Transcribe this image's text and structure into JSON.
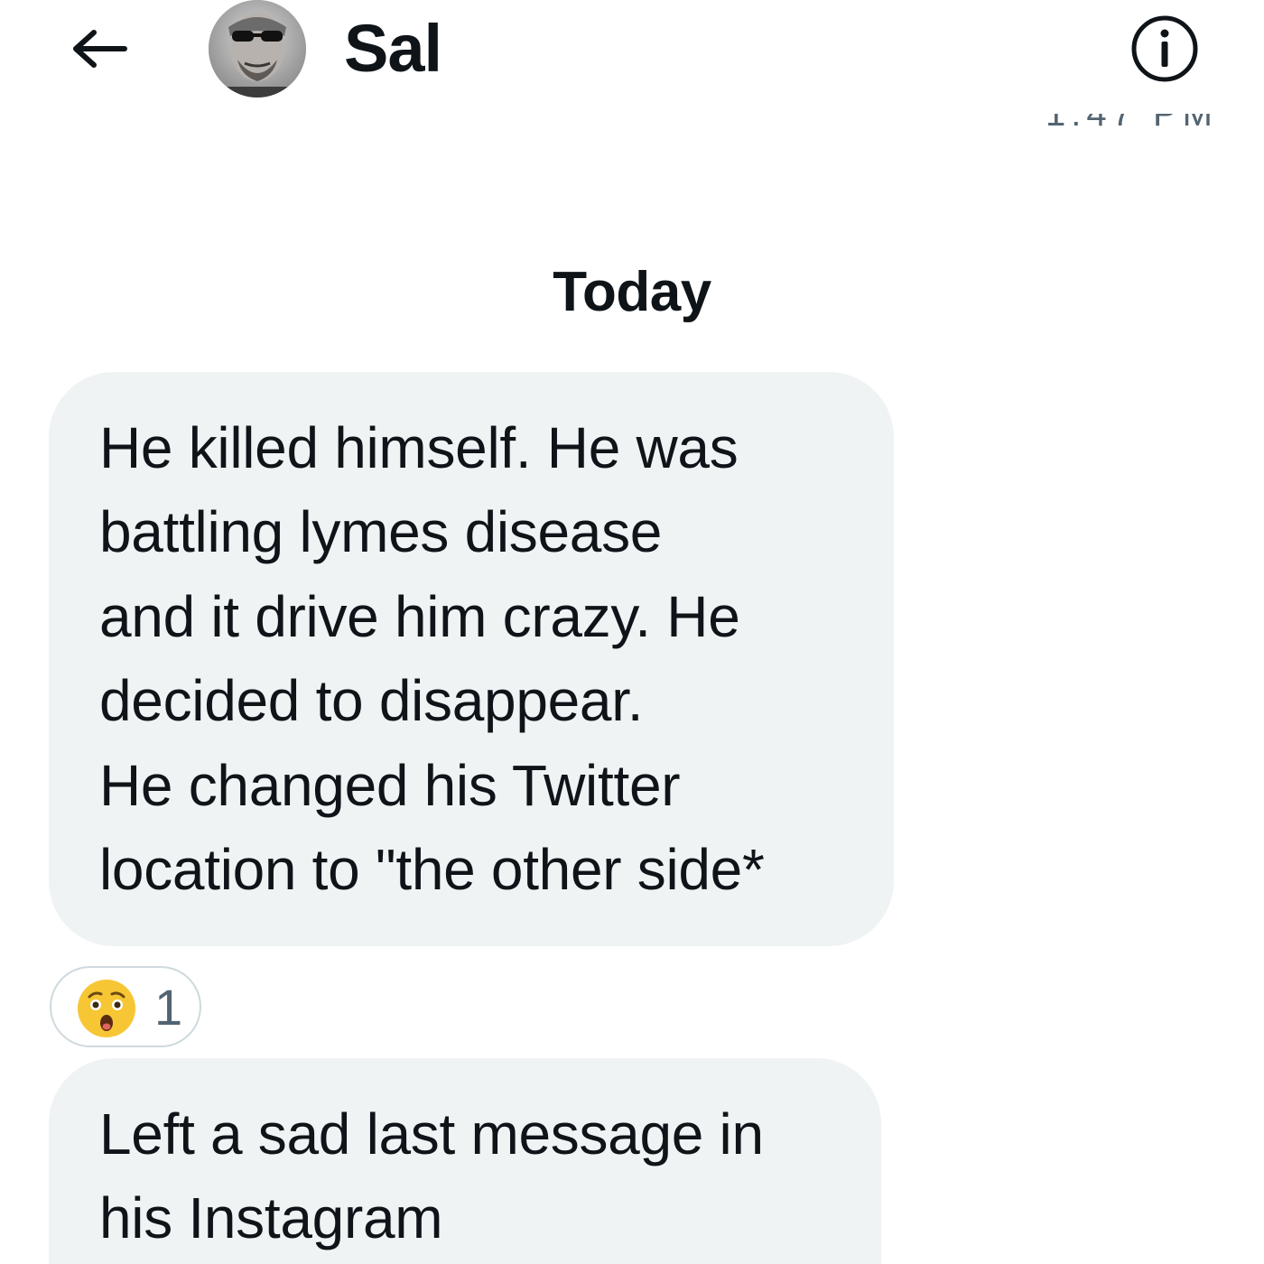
{
  "header": {
    "contact_name": "Sal"
  },
  "timestamp_cut": "1:47 PM",
  "day_divider": "Today",
  "messages": [
    {
      "lines": [
        "He killed himself. He was",
        "battling lymes disease",
        "and it drive him crazy. He",
        "decided to disappear.",
        "He changed his Twitter",
        "location to \"the other side*"
      ]
    },
    {
      "lines": [
        "Left a sad last message in",
        "his Instagram"
      ]
    }
  ],
  "reaction": {
    "emoji": "😲",
    "count": "1"
  },
  "colors": {
    "bubble_bg": "#eff3f4",
    "text": "#0f1419",
    "muted": "#536471",
    "border": "#cfd9de"
  }
}
